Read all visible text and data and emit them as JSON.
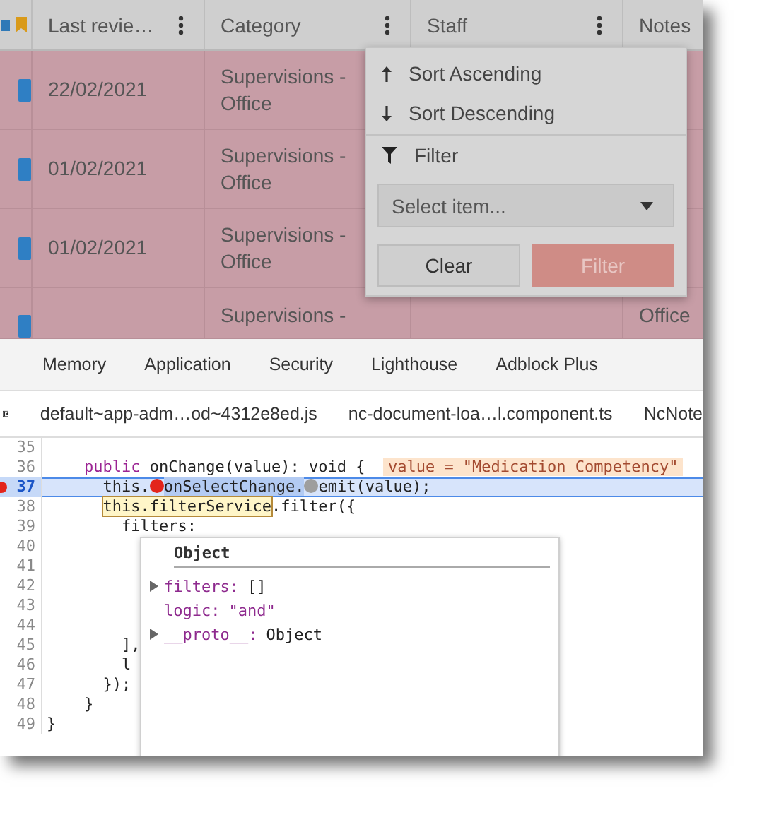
{
  "grid": {
    "columns": [
      {
        "label": "Last revie…",
        "menu": true
      },
      {
        "label": "Category",
        "menu": true
      },
      {
        "label": "Staff",
        "menu": true
      },
      {
        "label": "Notes",
        "menu": false
      }
    ],
    "rows": [
      {
        "date": "22/02/2021",
        "category": "Supervisions -\nOffice",
        "notes": ""
      },
      {
        "date": "01/02/2021",
        "category": "Supervisions -\nOffice",
        "notes": ""
      },
      {
        "date": "01/02/2021",
        "category": "Supervisions -\nOffice",
        "notes": ""
      },
      {
        "date": "",
        "category": "Supervisions -",
        "notes": "Office"
      }
    ]
  },
  "column_menu": {
    "items": [
      {
        "kind": "sort-up",
        "label": "Sort Ascending"
      },
      {
        "kind": "sort-down",
        "label": "Sort Descending"
      },
      {
        "kind": "filter",
        "label": "Filter"
      }
    ],
    "select": {
      "placeholder": "Select item..."
    },
    "buttons": [
      {
        "kind": "secondary",
        "label": "Clear"
      },
      {
        "kind": "primary",
        "label": "Filter"
      }
    ]
  },
  "devtools": {
    "tabs": [
      {
        "label": "Memory",
        "selected": false
      },
      {
        "label": "Application",
        "selected": false
      },
      {
        "label": "Security",
        "selected": false
      },
      {
        "label": "Lighthouse",
        "selected": false
      },
      {
        "label": "Adblock Plus",
        "selected": false
      }
    ],
    "files": [
      {
        "label": "default~app-adm…od~4312e8ed.js"
      },
      {
        "label": "nc-document-loa…l.component.ts"
      },
      {
        "label": "NcNote"
      }
    ],
    "lines": [
      {
        "number": "35",
        "current": false
      },
      {
        "number": "36",
        "current": false,
        "parts": [
          {
            "kind": "kw",
            "text": "    public"
          },
          {
            "kind": "plain",
            "text": " onChange(value): void {  "
          },
          {
            "kind": "inline-value",
            "text": "value = \"Medication Competency\""
          }
        ]
      },
      {
        "number": "37",
        "current": true,
        "parts": [
          {
            "kind": "plain",
            "text": "      this."
          },
          {
            "kind": "dot",
            "color": "#e3241b"
          },
          {
            "kind": "sel",
            "text": "onSelectChange."
          },
          {
            "kind": "dot",
            "color": "#9e9e9e"
          },
          {
            "kind": "plain",
            "text": "emit(value);"
          }
        ]
      },
      {
        "number": "38",
        "current": false,
        "parts": [
          {
            "kind": "hover",
            "text": "      this.filterService"
          },
          {
            "kind": "plain",
            "text": ".filter({"
          }
        ]
      },
      {
        "number": "39",
        "current": false,
        "parts": [
          {
            "kind": "plain",
            "text": "        filters:"
          }
        ]
      },
      {
        "number": "40",
        "current": false
      },
      {
        "number": "41",
        "current": false
      },
      {
        "number": "42",
        "current": false
      },
      {
        "number": "43",
        "current": false
      },
      {
        "number": "44",
        "current": false
      },
      {
        "number": "45",
        "current": false,
        "parts": [
          {
            "kind": "plain",
            "text": "        ],"
          }
        ]
      },
      {
        "number": "46",
        "current": false,
        "parts": [
          {
            "kind": "plain",
            "text": "        l"
          }
        ]
      },
      {
        "number": "47",
        "current": false,
        "parts": [
          {
            "kind": "plain",
            "text": "      });"
          }
        ]
      },
      {
        "number": "48",
        "current": false,
        "parts": [
          {
            "kind": "plain",
            "text": "    }"
          }
        ]
      },
      {
        "number": "49",
        "current": false,
        "parts": [
          {
            "kind": "plain",
            "text": "}"
          }
        ]
      }
    ],
    "popover": {
      "title": "Object",
      "entries": [
        {
          "expandable": true,
          "key": "filters:",
          "value": "[]"
        },
        {
          "expandable": false,
          "key": "logic:",
          "value": "\"and\""
        },
        {
          "expandable": true,
          "key": "__proto__:",
          "value": "Object"
        }
      ]
    }
  }
}
